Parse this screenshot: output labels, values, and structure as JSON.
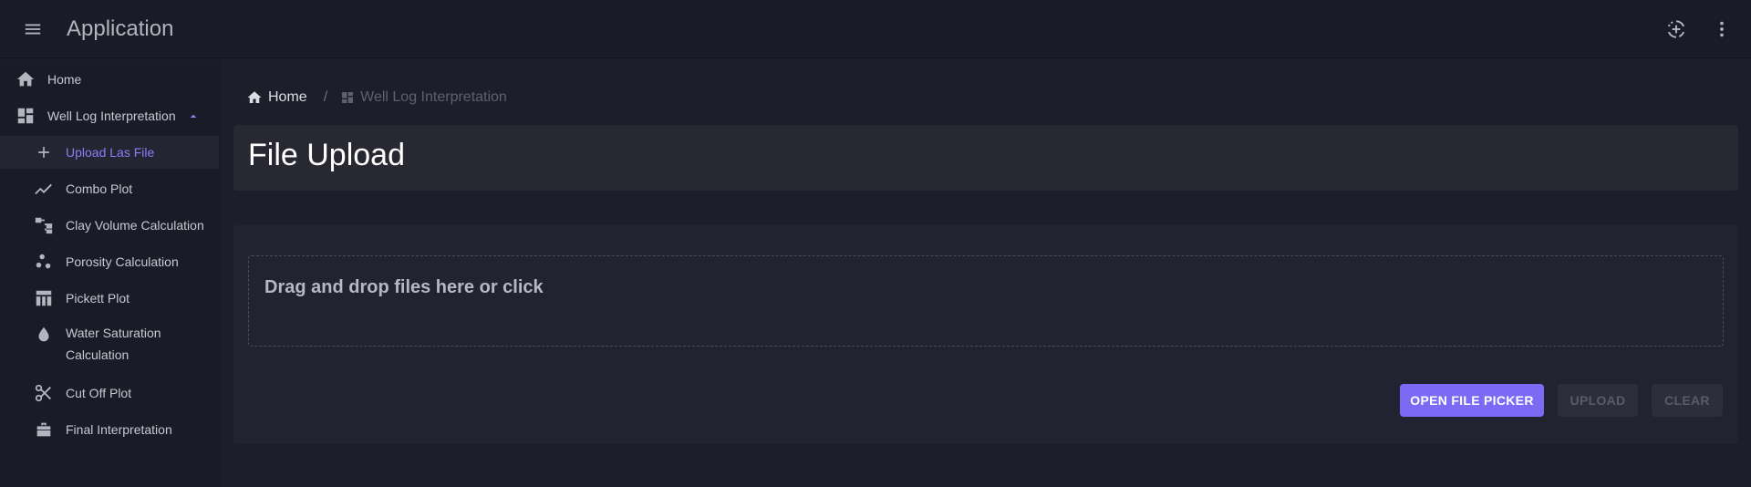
{
  "app": {
    "title": "Application"
  },
  "sidebar": {
    "items": [
      {
        "label": "Home",
        "icon": "home-icon"
      },
      {
        "label": "Well Log Interpretation",
        "icon": "dashboard-icon",
        "expand_icon": "caret-up-icon"
      },
      {
        "label": "Upload Las File",
        "icon": "plus-icon",
        "active": true
      },
      {
        "label": "Combo Plot",
        "icon": "trend-line-icon"
      },
      {
        "label": "Clay Volume Calculation",
        "icon": "account-tree-icon"
      },
      {
        "label": "Porosity Calculation",
        "icon": "scatter-dots-icon"
      },
      {
        "label": "Pickett Plot",
        "icon": "table-layout-icon"
      },
      {
        "label": "Water Saturation Calculation",
        "line1": "Water Saturation",
        "line2": "Calculation",
        "icon": "water-drop-icon"
      },
      {
        "label": "Cut Off Plot",
        "icon": "scissors-icon"
      },
      {
        "label": "Final Interpretation",
        "icon": "briefcase-icon"
      }
    ]
  },
  "breadcrumb": {
    "home": "Home",
    "separator": "/",
    "current": "Well Log Interpretation"
  },
  "page": {
    "title": "File Upload"
  },
  "upload": {
    "dropzone_text": "Drag and drop files here or click",
    "open_label": "OPEN FILE PICKER",
    "upload_label": "UPLOAD",
    "clear_label": "CLEAR"
  },
  "colors": {
    "accent": "#7c6af4",
    "active_text": "#8f7df5",
    "background": "#1e1e2b",
    "sidebar": "#1b1b27",
    "card": "#282833"
  }
}
